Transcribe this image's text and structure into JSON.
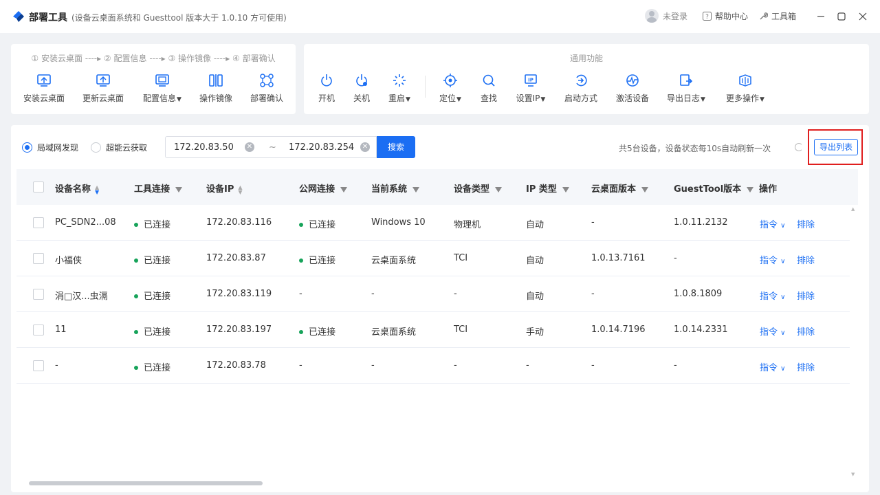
{
  "app": {
    "title": "部署工具",
    "subtitle": "(设备云桌面系统和 Guesttool 版本大于 1.0.10 方可使用)",
    "user": "未登录",
    "help": "帮助中心",
    "toolbox": "工具箱"
  },
  "steps_line": "① 安装云桌面 ----▸ ② 配置信息 ----▸ ③ 操作镜像 ----▸ ④ 部署确认",
  "left_tools": [
    {
      "label": "安装云桌面",
      "icon": "install-desktop-icon"
    },
    {
      "label": "更新云桌面",
      "icon": "update-desktop-icon"
    },
    {
      "label": "配置信息",
      "icon": "config-info-icon",
      "dropdown": true
    },
    {
      "label": "操作镜像",
      "icon": "mirror-icon"
    },
    {
      "label": "部署确认",
      "icon": "deploy-confirm-icon"
    }
  ],
  "right_title": "通用功能",
  "right_tools": [
    {
      "label": "开机",
      "icon": "power-on-icon"
    },
    {
      "label": "关机",
      "icon": "power-off-icon"
    },
    {
      "label": "重启",
      "icon": "restart-icon",
      "dropdown": true
    },
    {
      "label": "定位",
      "icon": "locate-icon",
      "dropdown": true
    },
    {
      "label": "查找",
      "icon": "search-icon"
    },
    {
      "label": "设置IP",
      "icon": "ip-icon",
      "dropdown": true
    },
    {
      "label": "启动方式",
      "icon": "boot-mode-icon"
    },
    {
      "label": "激活设备",
      "icon": "activate-icon"
    },
    {
      "label": "导出日志",
      "icon": "export-log-icon",
      "dropdown": true
    },
    {
      "label": "更多操作",
      "icon": "more-ops-icon",
      "dropdown": true
    }
  ],
  "filters": {
    "radio_lan": "局域网发现",
    "radio_cloud": "超能云获取",
    "ip_start": "172.20.83.50",
    "ip_sep": "~",
    "ip_end": "172.20.83.254",
    "search": "搜索",
    "status": "共5台设备，设备状态每10s自动刷新一次",
    "export": "导出列表"
  },
  "columns": [
    "设备名称",
    "工具连接",
    "设备IP",
    "公网连接",
    "当前系统",
    "设备类型",
    "IP 类型",
    "云桌面版本",
    "GuestTool版本",
    "操作"
  ],
  "rows": [
    {
      "name": "PC_SDN2...08",
      "tool": "已连接",
      "ip": "172.20.83.116",
      "public": "已连接",
      "os": "Windows 10",
      "type": "物理机",
      "iptype": "自动",
      "cloud": "-",
      "guest": "1.0.11.2132"
    },
    {
      "name": "小福侠",
      "tool": "已连接",
      "ip": "172.20.83.87",
      "public": "已连接",
      "os": "云桌面系统",
      "type": "TCI",
      "iptype": "自动",
      "cloud": "1.0.13.7161",
      "guest": "-"
    },
    {
      "name": "涓□汉...虫滆",
      "tool": "已连接",
      "ip": "172.20.83.119",
      "public": "-",
      "os": "-",
      "type": "-",
      "iptype": "自动",
      "cloud": "-",
      "guest": "1.0.8.1809"
    },
    {
      "name": "11",
      "tool": "已连接",
      "ip": "172.20.83.197",
      "public": "已连接",
      "os": "云桌面系统",
      "type": "TCI",
      "iptype": "手动",
      "cloud": "1.0.14.7196",
      "guest": "1.0.14.2331"
    },
    {
      "name": "-",
      "tool": "已连接",
      "ip": "172.20.83.78",
      "public": "-",
      "os": "-",
      "type": "-",
      "iptype": "-",
      "cloud": "-",
      "guest": "-"
    }
  ],
  "row_actions": {
    "command": "指令",
    "remove": "排除"
  },
  "colors": {
    "accent": "#1b6ef3",
    "connected": "#17a35a",
    "highlight": "#e01e1e"
  }
}
